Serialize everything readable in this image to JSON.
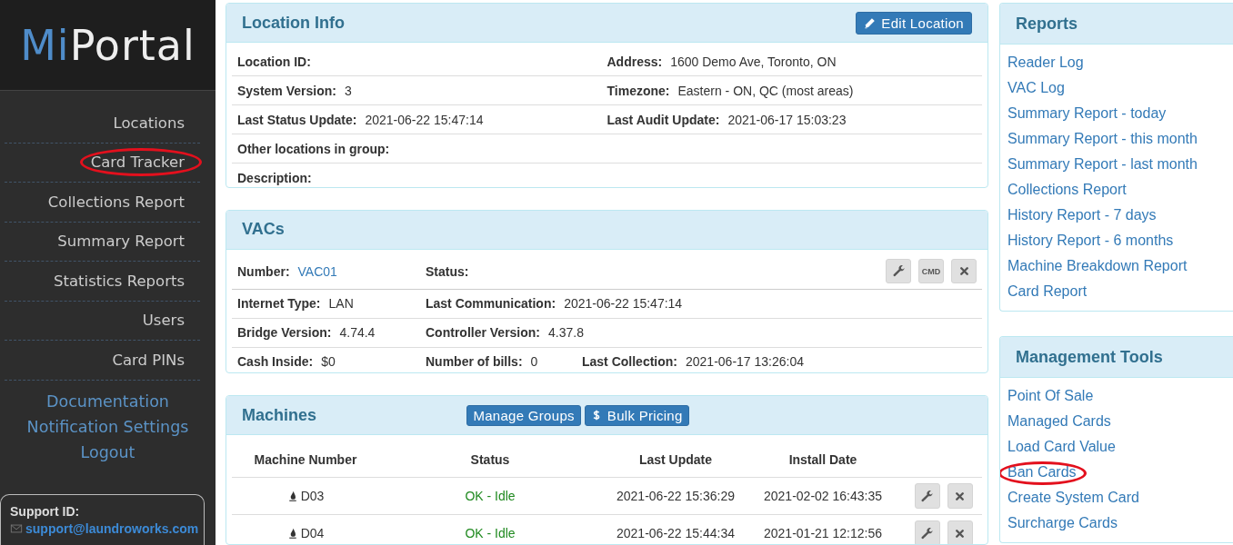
{
  "logo": {
    "prefix": "Mi",
    "suffix": "Portal"
  },
  "sidebar": {
    "menu": [
      {
        "label": "Locations",
        "circled": false
      },
      {
        "label": "Card Tracker",
        "circled": true
      },
      {
        "label": "Collections Report",
        "circled": false
      },
      {
        "label": "Summary Report",
        "circled": false
      },
      {
        "label": "Statistics Reports",
        "circled": false
      },
      {
        "label": "Users",
        "circled": false
      },
      {
        "label": "Card PINs",
        "circled": false
      }
    ],
    "links": [
      "Documentation",
      "Notification Settings",
      "Logout"
    ],
    "support": {
      "label": "Support ID:",
      "email": "support@laundroworks.com"
    }
  },
  "location_info": {
    "title": "Location Info",
    "edit_button": "Edit Location",
    "rows": [
      [
        {
          "label": "Location ID:"
        },
        {
          "label": "Address:",
          "value": "1600 Demo Ave, Toronto, ON"
        }
      ],
      [
        {
          "label": "System Version:",
          "value": "3"
        },
        {
          "label": "Timezone:",
          "value": "Eastern - ON, QC (most areas)"
        }
      ],
      [
        {
          "label": "Last Status Update:",
          "value": "2021-06-22 15:47:14"
        },
        {
          "label": "Last Audit Update:",
          "value": "2021-06-17 15:03:23"
        }
      ],
      [
        {
          "label": "Other locations in group:"
        }
      ],
      [
        {
          "label": "Description:"
        }
      ]
    ]
  },
  "vacs": {
    "title": "VACs",
    "rows": [
      [
        {
          "label": "Number:",
          "value": "VAC01",
          "link": true
        },
        {
          "label": "Status:"
        }
      ],
      [
        {
          "label": "Internet Type:",
          "value": "LAN"
        },
        {
          "label": "Last Communication:",
          "value": "2021-06-22 15:47:14"
        }
      ],
      [
        {
          "label": "Bridge Version:",
          "value": "4.74.4"
        },
        {
          "label": "Controller Version:",
          "value": "4.37.8"
        }
      ],
      [
        {
          "label": "Cash Inside:",
          "value": "$0"
        },
        {
          "label": "Number of bills:",
          "value": "0"
        },
        {
          "label": "Last Collection:",
          "value": "2021-06-17 13:26:04"
        }
      ]
    ],
    "actions": [
      {
        "kind": "wrench"
      },
      {
        "kind": "text",
        "label": "CMD"
      },
      {
        "kind": "close"
      }
    ]
  },
  "machines": {
    "title": "Machines",
    "buttons": [
      {
        "label": "Manage Groups",
        "kind": "plain"
      },
      {
        "label": "Bulk Pricing",
        "kind": "pricing"
      }
    ],
    "columns": [
      "Machine Number",
      "Status",
      "Last Update",
      "Install Date"
    ],
    "rows": [
      {
        "number": "D03",
        "status": "OK - Idle",
        "last_update": "2021-06-22 15:36:29",
        "install_date": "2021-02-02 16:43:35"
      },
      {
        "number": "D04",
        "status": "OK - Idle",
        "last_update": "2021-06-22 15:44:34",
        "install_date": "2021-01-21 12:12:56"
      }
    ]
  },
  "reports": {
    "title": "Reports",
    "links": [
      {
        "label": "Reader Log",
        "circled": false
      },
      {
        "label": "VAC Log",
        "circled": false
      },
      {
        "label": "Summary Report - today",
        "circled": false
      },
      {
        "label": "Summary Report - this month",
        "circled": false
      },
      {
        "label": "Summary Report - last month",
        "circled": false
      },
      {
        "label": "Collections Report",
        "circled": false
      },
      {
        "label": "History Report - 7 days",
        "circled": false
      },
      {
        "label": "History Report - 6 months",
        "circled": false
      },
      {
        "label": "Machine Breakdown Report",
        "circled": false
      },
      {
        "label": "Card Report",
        "circled": false
      }
    ]
  },
  "management_tools": {
    "title": "Management Tools",
    "links": [
      {
        "label": "Point Of Sale",
        "circled": false
      },
      {
        "label": "Managed Cards",
        "circled": false
      },
      {
        "label": "Load Card Value",
        "circled": false
      },
      {
        "label": "Ban Cards",
        "circled": true
      },
      {
        "label": "Create System Card",
        "circled": false
      },
      {
        "label": "Surcharge Cards",
        "circled": false
      }
    ]
  }
}
